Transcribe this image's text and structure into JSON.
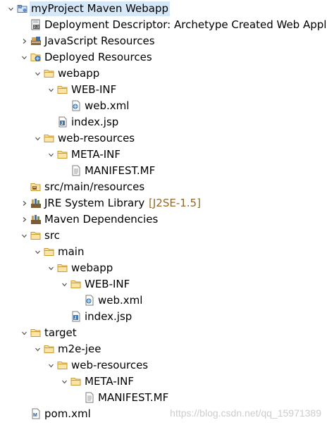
{
  "tree": {
    "rows": [
      {
        "id": "project",
        "label": "myProject Maven Webapp",
        "depth": 0,
        "twisty": "expanded",
        "icon": "maven-project-icon",
        "selected": true
      },
      {
        "id": "deployment-descriptor",
        "label": "Deployment Descriptor: Archetype Created Web Appli",
        "depth": 1,
        "twisty": "none",
        "icon": "deployment-descriptor-icon"
      },
      {
        "id": "javascript-resources",
        "label": "JavaScript Resources",
        "depth": 1,
        "twisty": "collapsed",
        "icon": "js-resources-icon"
      },
      {
        "id": "deployed-resources",
        "label": "Deployed Resources",
        "depth": 1,
        "twisty": "expanded",
        "icon": "deployed-resources-icon"
      },
      {
        "id": "webapp",
        "label": "webapp",
        "depth": 2,
        "twisty": "expanded",
        "icon": "folder-icon"
      },
      {
        "id": "web-inf",
        "label": "WEB-INF",
        "depth": 3,
        "twisty": "expanded",
        "icon": "folder-icon"
      },
      {
        "id": "web-xml",
        "label": "web.xml",
        "depth": 4,
        "twisty": "none",
        "icon": "xml-file-icon"
      },
      {
        "id": "index-jsp",
        "label": "index.jsp",
        "depth": 3,
        "twisty": "none",
        "icon": "jsp-file-icon"
      },
      {
        "id": "web-resources",
        "label": "web-resources",
        "depth": 2,
        "twisty": "expanded",
        "icon": "folder-icon"
      },
      {
        "id": "meta-inf",
        "label": "META-INF",
        "depth": 3,
        "twisty": "expanded",
        "icon": "folder-icon"
      },
      {
        "id": "manifest-mf",
        "label": "MANIFEST.MF",
        "depth": 4,
        "twisty": "none",
        "icon": "text-file-icon"
      },
      {
        "id": "src-main-resources",
        "label": "src/main/resources",
        "depth": 1,
        "twisty": "none",
        "icon": "source-folder-icon"
      },
      {
        "id": "jre-library",
        "label": "JRE System Library",
        "suffix": "[J2SE-1.5]",
        "depth": 1,
        "twisty": "collapsed",
        "icon": "library-icon"
      },
      {
        "id": "maven-dependencies",
        "label": "Maven Dependencies",
        "depth": 1,
        "twisty": "collapsed",
        "icon": "library-icon"
      },
      {
        "id": "src",
        "label": "src",
        "depth": 1,
        "twisty": "expanded",
        "icon": "folder-icon"
      },
      {
        "id": "main",
        "label": "main",
        "depth": 2,
        "twisty": "expanded",
        "icon": "folder-icon"
      },
      {
        "id": "src-webapp",
        "label": "webapp",
        "depth": 3,
        "twisty": "expanded",
        "icon": "folder-icon"
      },
      {
        "id": "src-web-inf",
        "label": "WEB-INF",
        "depth": 4,
        "twisty": "expanded",
        "icon": "folder-icon"
      },
      {
        "id": "src-web-xml",
        "label": "web.xml",
        "depth": 5,
        "twisty": "none",
        "icon": "xml-file-icon"
      },
      {
        "id": "src-index-jsp",
        "label": "index.jsp",
        "depth": 4,
        "twisty": "none",
        "icon": "jsp-file-icon"
      },
      {
        "id": "target",
        "label": "target",
        "depth": 1,
        "twisty": "expanded",
        "icon": "folder-icon"
      },
      {
        "id": "m2e-jee",
        "label": "m2e-jee",
        "depth": 2,
        "twisty": "expanded",
        "icon": "folder-icon"
      },
      {
        "id": "target-web-resources",
        "label": "web-resources",
        "depth": 3,
        "twisty": "expanded",
        "icon": "folder-icon"
      },
      {
        "id": "target-meta-inf",
        "label": "META-INF",
        "depth": 4,
        "twisty": "expanded",
        "icon": "folder-icon"
      },
      {
        "id": "target-manifest-mf",
        "label": "MANIFEST.MF",
        "depth": 5,
        "twisty": "none",
        "icon": "text-file-icon"
      },
      {
        "id": "pom-xml",
        "label": "pom.xml",
        "depth": 1,
        "twisty": "none",
        "icon": "pom-file-icon"
      }
    ]
  },
  "watermark": "https://blog.csdn.net/qq_15971389",
  "colors": {
    "selection": "#d6e8f8",
    "folder": "#e8b84a",
    "decoration": "#8f6a2b"
  }
}
